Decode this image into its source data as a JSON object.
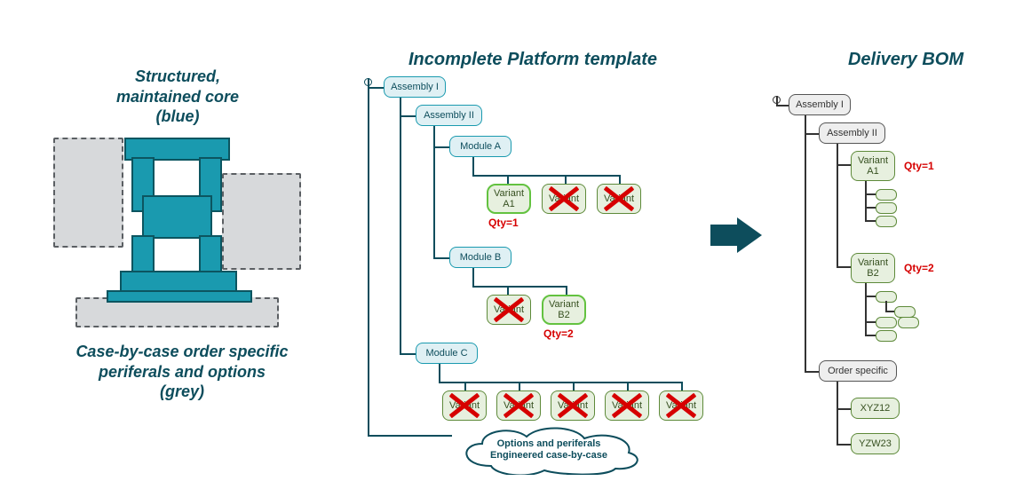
{
  "titles": {
    "center": "Incomplete Platform template",
    "right": "Delivery BOM",
    "left_top": "Structured,\nmaintained core\n(blue)",
    "left_bottom": "Case-by-case order specific\nperiferals and options\n(grey)"
  },
  "template_tree": {
    "assembly1": "Assembly I",
    "assembly2": "Assembly II",
    "moduleA": "Module A",
    "moduleB": "Module B",
    "moduleC": "Module C",
    "variantA1": "Variant\nA1",
    "variantA2": "Variant",
    "variantA3": "Variant",
    "variantB1": "Variant",
    "variantB2": "Variant\nB2",
    "variantC": "Variant",
    "qtyA1": "Qty=1",
    "qtyB2": "Qty=2",
    "cloud_line1": "Options and periferals",
    "cloud_line2": "Engineered case-by-case"
  },
  "delivery_tree": {
    "assembly1": "Assembly I",
    "assembly2": "Assembly II",
    "variantA1": "Variant\nA1",
    "variantB2": "Variant\nB2",
    "order_specific": "Order specific",
    "xyz12": "XYZ12",
    "yzw23": "YZW23",
    "qtyA1": "Qty=1",
    "qtyB2": "Qty=2"
  }
}
